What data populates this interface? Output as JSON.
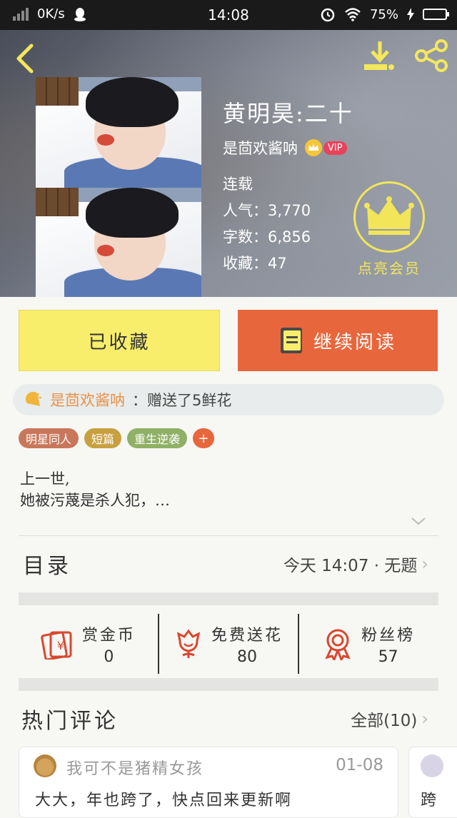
{
  "status_bar": {
    "speed": "0K/s",
    "time": "14:08",
    "battery": "75%"
  },
  "book": {
    "title": "黄明昊:二十",
    "author": "是茴欢酱呐",
    "vip": "VIP",
    "status": "连载",
    "popularity_label": "人气：",
    "popularity": "3,770",
    "words_label": "字数：",
    "words": "6,856",
    "favorites_label": "收藏：",
    "favorites": "47"
  },
  "member": {
    "label": "点亮会员"
  },
  "buttons": {
    "favorited": "已收藏",
    "continue_reading": "继续阅读"
  },
  "gift": {
    "user": "是茴欢酱呐",
    "action": "：赠送了5鲜花"
  },
  "tags": [
    {
      "label": "明星同人",
      "color": "#c9775a"
    },
    {
      "label": "短篇",
      "color": "#c8a040"
    },
    {
      "label": "重生逆袭",
      "color": "#8fb066"
    }
  ],
  "tag_add": "+",
  "intro": {
    "line1": "上一世,",
    "line2": "她被污蔑是杀人犯，…"
  },
  "toc": {
    "label": "目录",
    "updated": "今天 14:07 · 无题"
  },
  "stats": [
    {
      "name": "赏金币",
      "value": "0"
    },
    {
      "name": "免费送花",
      "value": "80"
    },
    {
      "name": "粉丝榜",
      "value": "57"
    }
  ],
  "hot_comments": {
    "label": "热门评论",
    "all": "全部(10)"
  },
  "comments": [
    {
      "user": "我可不是猪精女孩",
      "date": "01-08",
      "text": "大大，年也跨了，快点回来更新啊"
    },
    {
      "text": "跨"
    }
  ],
  "colors": {
    "accent_orange": "#e8663c",
    "fav_yellow": "#f8ee6c",
    "member_gold": "#f2e55a"
  }
}
